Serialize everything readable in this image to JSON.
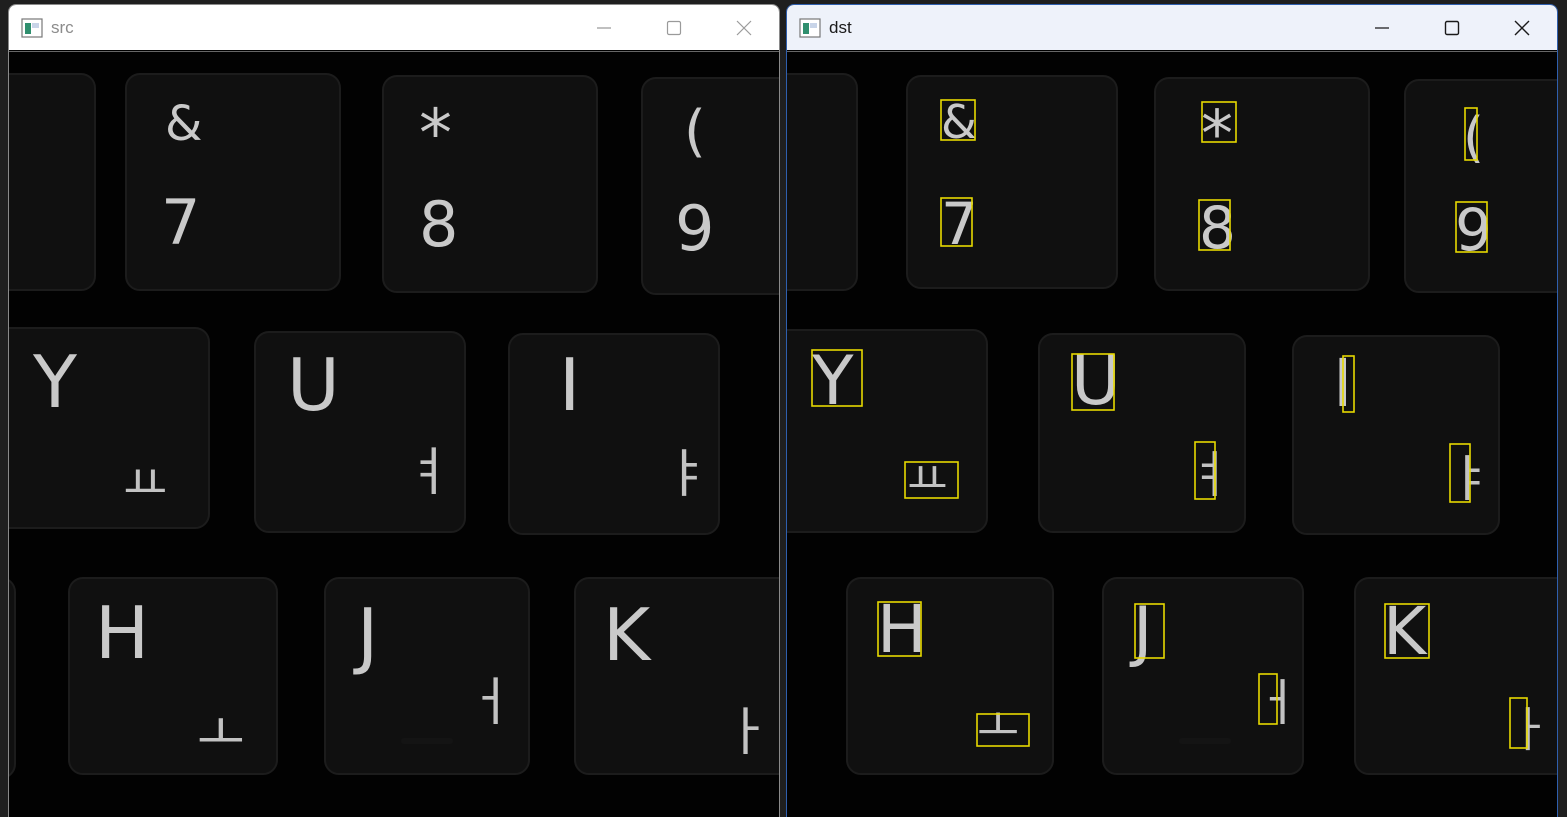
{
  "windows": [
    {
      "id": "src",
      "title": "src",
      "show_boxes": false
    },
    {
      "id": "dst",
      "title": "dst",
      "show_boxes": true
    }
  ],
  "keys": {
    "row1": [
      {
        "top": "&",
        "bottom": "7"
      },
      {
        "top": "*",
        "bottom": "8"
      },
      {
        "top": "(",
        "bottom": "9"
      }
    ],
    "row2": [
      {
        "latin": "Y",
        "hangul": "ㅛ"
      },
      {
        "latin": "U",
        "hangul": "ㅕ"
      },
      {
        "latin": "I",
        "hangul": "ㅑ"
      }
    ],
    "row3": [
      {
        "latin": "H",
        "hangul": "ㅗ"
      },
      {
        "latin": "J",
        "hangul": "ㅓ"
      },
      {
        "latin": "K",
        "hangul": "ㅏ"
      }
    ]
  },
  "colors": {
    "bbox": "#e6d800",
    "key_face": "#101010",
    "glyph": "#c9c9c9",
    "background": "#040404"
  }
}
